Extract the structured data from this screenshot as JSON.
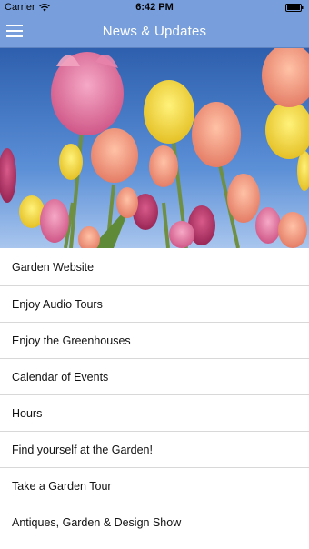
{
  "status_bar": {
    "carrier": "Carrier",
    "time": "6:42 PM"
  },
  "header": {
    "title": "News & Updates"
  },
  "icons": {
    "menu": "hamburger-icon",
    "wifi": "wifi-icon",
    "battery": "battery-icon"
  },
  "colors": {
    "header_bg": "#789fdb",
    "header_text": "#ffffff",
    "divider": "#d8d8d8"
  },
  "menu_items": [
    {
      "label": "Garden Website"
    },
    {
      "label": "Enjoy Audio Tours"
    },
    {
      "label": "Enjoy the Greenhouses"
    },
    {
      "label": "Calendar of Events"
    },
    {
      "label": "Hours"
    },
    {
      "label": "Find yourself at the Garden!"
    },
    {
      "label": "Take a Garden Tour"
    },
    {
      "label": "Antiques, Garden & Design Show"
    }
  ]
}
